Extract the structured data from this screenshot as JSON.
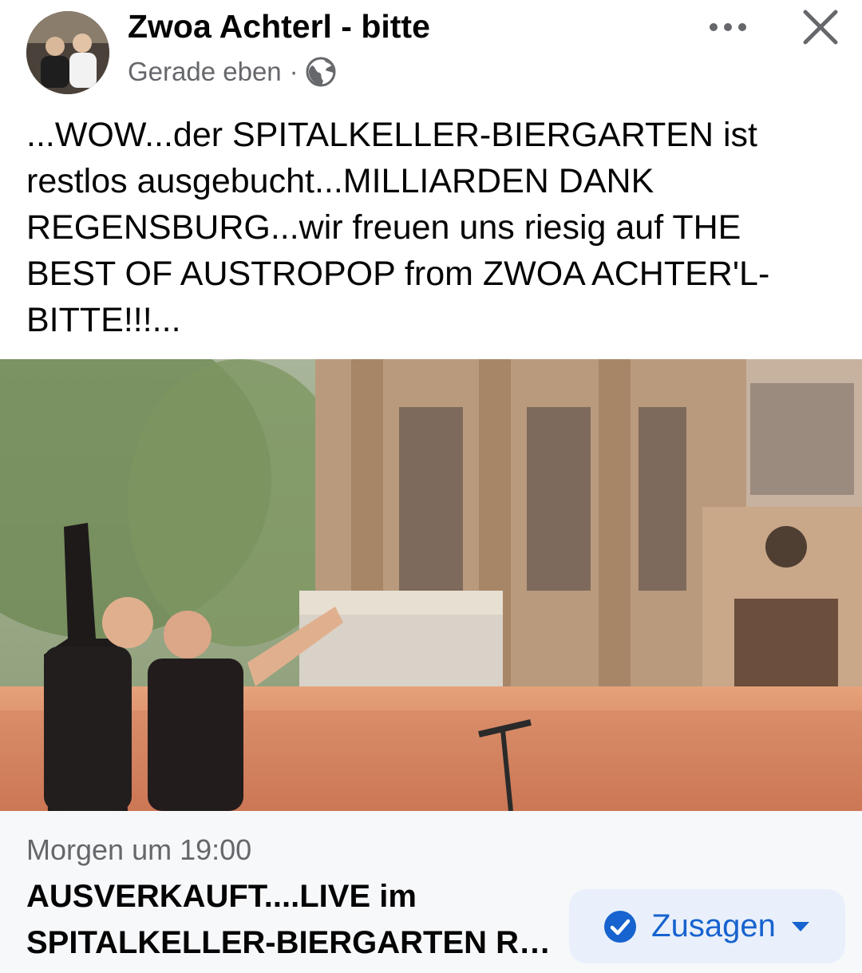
{
  "post": {
    "page_name": "Zwoa Achterl - bitte",
    "timestamp": "Gerade eben",
    "separator": "·",
    "audience_icon": "globe-icon",
    "more_icon": "more-horizontal-icon",
    "close_icon": "close-icon",
    "text": "...WOW...der SPITALKELLER-BIERGARTEN ist restlos ausgebucht...MILLIARDEN DANK REGENSBURG...wir freuen uns riesig auf THE BEST OF AUSTROPOP from ZWOA ACHTER'L-BITTE!!!..."
  },
  "event": {
    "time": "Morgen um 19:00",
    "title_line1": "AUSVERKAUFT....LIVE im",
    "title_line2": "SPITALKELLER-BIERGARTEN REG...",
    "going_button": {
      "label": "Zusagen",
      "icon": "checkmark-circle-icon",
      "dropdown_icon": "caret-down-icon"
    }
  },
  "colors": {
    "accent": "#1763cf",
    "button_bg": "#e9f0fc",
    "secondary_text": "#65676b",
    "card_bg": "#f7f8fa"
  }
}
